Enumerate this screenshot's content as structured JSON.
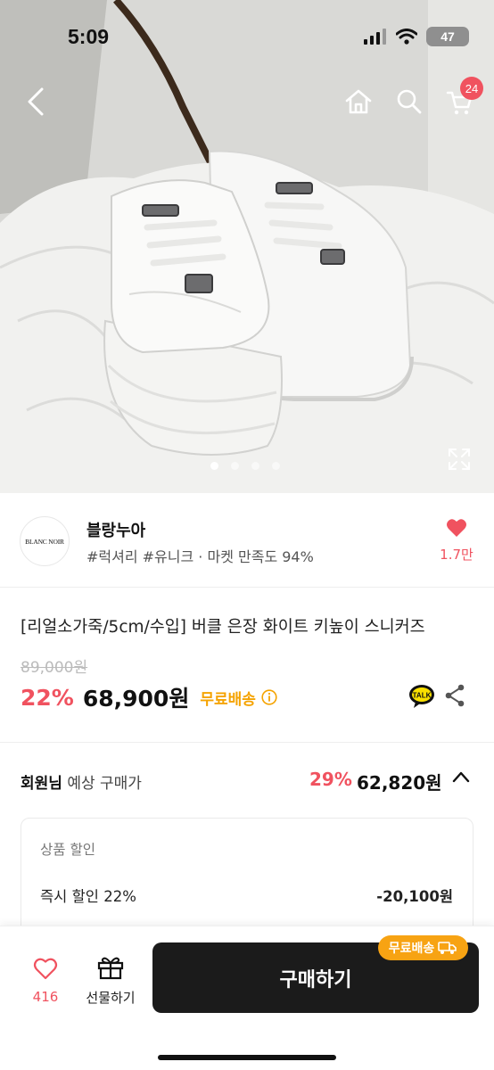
{
  "status": {
    "time": "5:09",
    "battery": "47"
  },
  "hero": {
    "cart_count": "24",
    "total_images": 4,
    "current_image": 1
  },
  "seller": {
    "logo_text": "BLANC NOIR",
    "name": "블랑누아",
    "tags": "#럭셔리 #유니크 · 마켓 만족도 94%",
    "like_count": "1.7만"
  },
  "product": {
    "title": "[리얼소가죽/5cm/수입] 버클 은장 화이트 키높이 스니커즈",
    "original_price": "89,000원",
    "discount": "22%",
    "sale_price": "68,900원",
    "free_shipping": "무료배송"
  },
  "member_price": {
    "label_strong": "회원님",
    "label_rest": " 예상 구매가",
    "discount": "29%",
    "price": "62,820원"
  },
  "discount_detail": {
    "heading": "상품 할인",
    "items": [
      {
        "label": "즉시 할인 22%",
        "value": "-20,100원"
      }
    ]
  },
  "bottom_bar": {
    "like_count": "416",
    "gift_label": "선물하기",
    "buy_label": "구매하기",
    "ship_badge": "무료배송"
  },
  "colors": {
    "accent": "#f0525f",
    "ship": "#f5a300",
    "buy_button": "#1b1b1b"
  }
}
